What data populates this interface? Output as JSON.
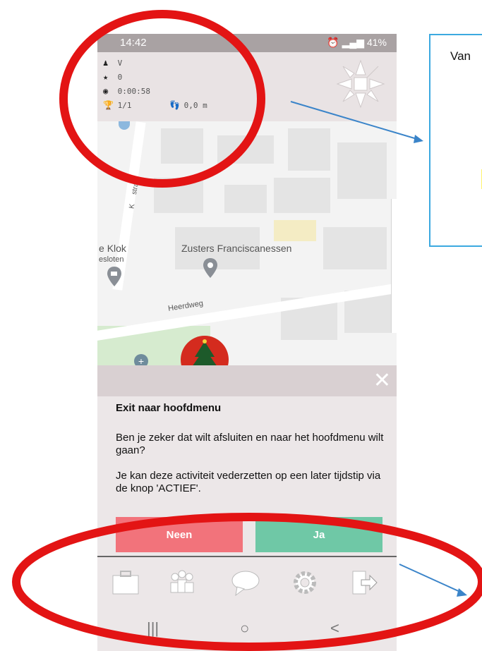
{
  "status": {
    "time": "14:42",
    "battery": "41%"
  },
  "hud": {
    "player": "V",
    "stars": "0",
    "timer": "0:00:58",
    "trophy": "1/1",
    "distance": "0,0 m"
  },
  "map": {
    "labels": [
      "Zusters Franciscanessen",
      "Heerdweg",
      "Klok",
      "esloten",
      "K",
      "straat"
    ]
  },
  "dialog": {
    "title": "Exit naar hoofdmenu",
    "body1": "Ben je zeker dat wilt afsluiten en naar het hoofdmenu wilt gaan?",
    "body2": "Je kan deze activiteit vederzetten op een later tijdstip via de knop 'ACTIEF'.",
    "no_label": "Neen",
    "yes_label": "Ja"
  },
  "toolbar": {
    "icons": [
      "briefcase-icon",
      "team-icon",
      "chat-icon",
      "gear-icon",
      "exit-icon"
    ]
  },
  "navbar": {
    "recent": "|||",
    "home": "○",
    "back": "<"
  },
  "callout": {
    "text": "Van"
  },
  "colors": {
    "annotation_red": "#e31414",
    "annotation_blue": "#3a84c9",
    "no": "#f2737b",
    "yes": "#6fc8a6"
  }
}
